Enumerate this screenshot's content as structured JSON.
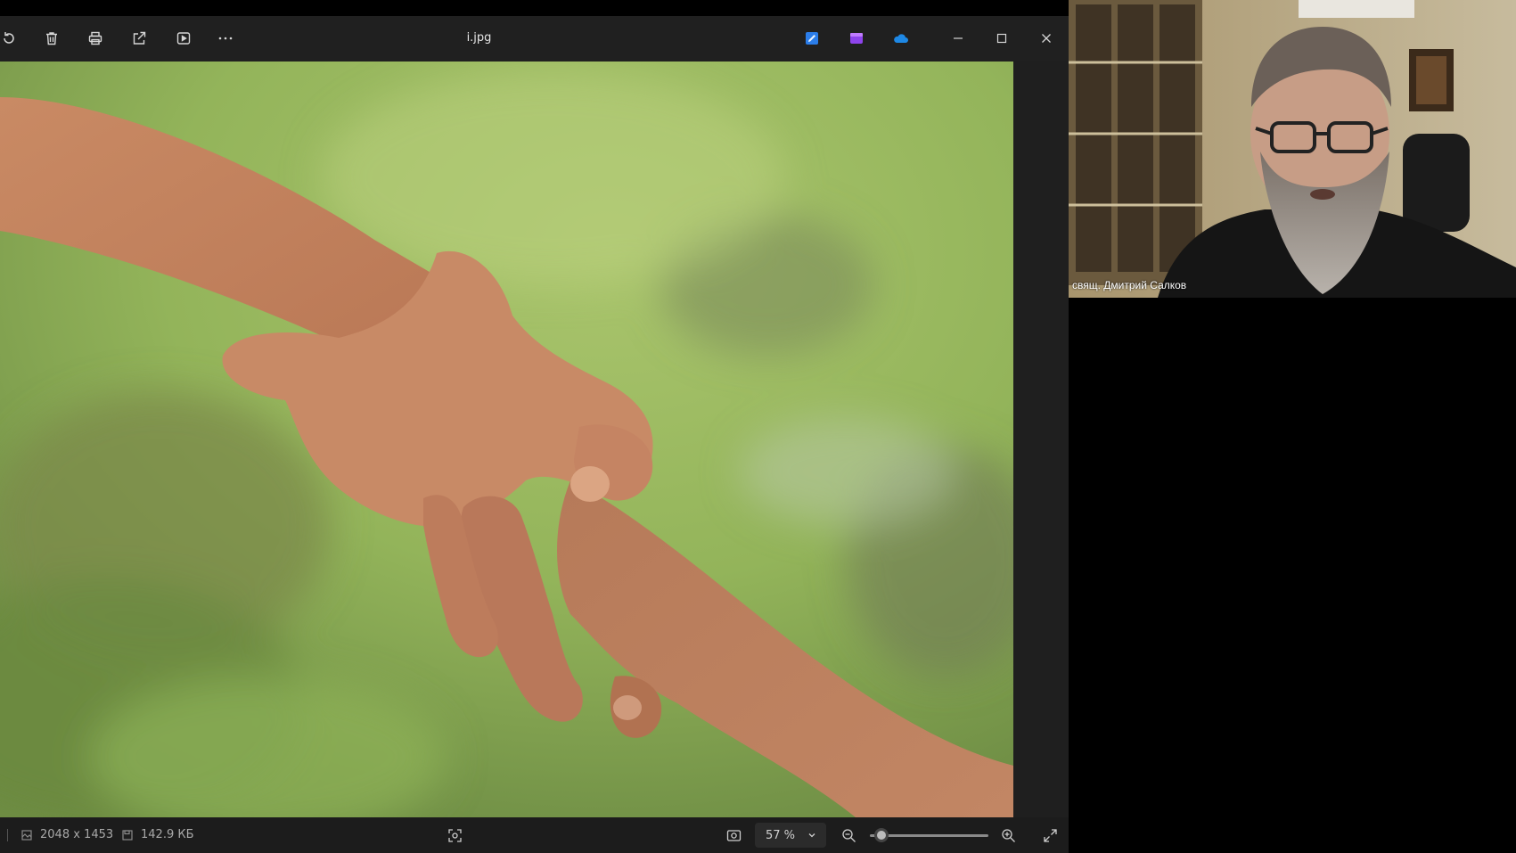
{
  "viewer": {
    "file_name": "i.jpg",
    "dimensions": "2048 x 1453",
    "file_size": "142.9 КБ",
    "zoom": "57 %",
    "zoom_level": 0.1,
    "toolbar_icons": [
      "rotate-icon",
      "delete-icon",
      "print-icon",
      "share-icon",
      "slideshow-icon",
      "more-icon"
    ],
    "app_icons": [
      "edit-app-icon",
      "clipchamp-icon",
      "onedrive-icon"
    ],
    "window_controls": [
      "minimize-icon",
      "maximize-icon",
      "close-icon"
    ],
    "colors": {
      "titlebar": "#202020",
      "statusbar": "#1c1c1c",
      "onedrive": "#1e88e5",
      "clipchamp": "#8e44ec"
    }
  },
  "call": {
    "participant_name": "свящ. Дмитрий Салков"
  }
}
